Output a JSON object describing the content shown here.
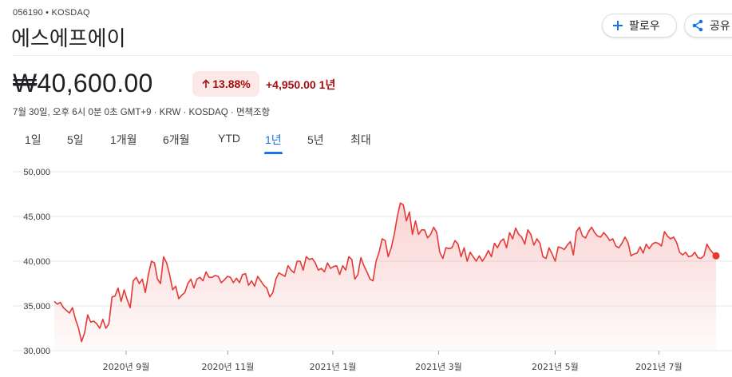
{
  "header": {
    "ticker": "056190 • KOSDAQ",
    "name": "에스에프에이",
    "follow_label": "팔로우",
    "share_label": "공유"
  },
  "quote": {
    "currency_symbol": "₩",
    "price": "40,600.00",
    "pct_change": "13.88%",
    "abs_change": "+4,950.00",
    "period": "1년",
    "meta": "7월 30일, 오후 6시 0분 0초 GMT+9 · KRW · KOSDAQ · 면책조항"
  },
  "tabs": [
    "1일",
    "5일",
    "1개월",
    "6개월",
    "YTD",
    "1년",
    "5년",
    "최대"
  ],
  "active_tab": "1년",
  "colors": {
    "line": "#e53935",
    "fill": "#fdeceb",
    "up": "#a50e0e",
    "up_bg": "#fce8e6",
    "accent": "#1a73e8"
  },
  "chart_data": {
    "type": "area",
    "ylim": [
      30000,
      50000
    ],
    "y_ticks": [
      "50,000",
      "45,000",
      "40,000",
      "35,000",
      "30,000"
    ],
    "y_tick_values": [
      50000,
      45000,
      40000,
      35000,
      30000
    ],
    "x_tick_labels": [
      "2020년 9월",
      "2020년 11월",
      "2021년 1월",
      "2021년 3월",
      "2021년 5월",
      "2021년 7월"
    ],
    "x_tick_positions": [
      0.106,
      0.256,
      0.411,
      0.567,
      0.739,
      0.892
    ],
    "series": [
      {
        "values": [
          35500,
          35200,
          35400,
          34800,
          34500,
          34200,
          34800,
          33500,
          32500,
          31000,
          32000,
          34000,
          33200,
          33300,
          33000,
          32500,
          33500,
          32500,
          33000,
          36000,
          36100,
          37000,
          35500,
          36800,
          35700,
          34800,
          37800,
          38200,
          37500,
          38000,
          36500,
          38500,
          40000,
          39800,
          38000,
          37500,
          40500,
          39800,
          38500,
          36800,
          37200,
          35800,
          36200,
          36500,
          37500,
          38000,
          37000,
          38000,
          38200,
          37800,
          38800,
          38200,
          38200,
          38400,
          38300,
          37600,
          37900,
          38300,
          38200,
          37600,
          38100,
          37600,
          38500,
          38600,
          37300,
          37800,
          37200,
          38300,
          37800,
          37300,
          37000,
          36000,
          36500,
          38000,
          38700,
          38500,
          38300,
          39500,
          39000,
          38700,
          40000,
          40000,
          39000,
          40500,
          40200,
          40300,
          39800,
          39000,
          39200,
          38800,
          39800,
          39200,
          39400,
          39500,
          38500,
          39500,
          39000,
          40500,
          40200,
          38000,
          38500,
          40400,
          39500,
          38800,
          38000,
          37800,
          40000,
          41000,
          42500,
          42300,
          40500,
          41500,
          43000,
          45000,
          46500,
          46300,
          44500,
          45500,
          43000,
          44500,
          43000,
          43500,
          43500,
          42600,
          43000,
          43800,
          43200,
          41000,
          40300,
          41500,
          41400,
          41500,
          42300,
          41900,
          40500,
          41500,
          40000,
          41000,
          40500,
          40000,
          40600,
          40000,
          40500,
          41200,
          40500,
          42000,
          41500,
          42200,
          42500,
          41500,
          43200,
          42500,
          43700,
          43000,
          42700,
          41900,
          43500,
          43000,
          41800,
          42500,
          42000,
          40500,
          40300,
          41500,
          40800,
          40000,
          41600,
          41500,
          41300,
          41800,
          42200,
          40700,
          43300,
          43800,
          42800,
          42600,
          43300,
          43800,
          43200,
          42800,
          42700,
          43200,
          42800,
          42300,
          42500,
          41700,
          41500,
          42000,
          42700,
          42100,
          40600,
          40800,
          40900,
          41600,
          40900,
          41900,
          41400,
          41900,
          42100,
          42000,
          41700,
          43300,
          42800,
          42500,
          42700,
          42100,
          41000,
          40700,
          41000,
          40500,
          40600,
          41000,
          40400,
          40300,
          40600,
          41900,
          41300,
          40900,
          40600
        ]
      }
    ]
  }
}
